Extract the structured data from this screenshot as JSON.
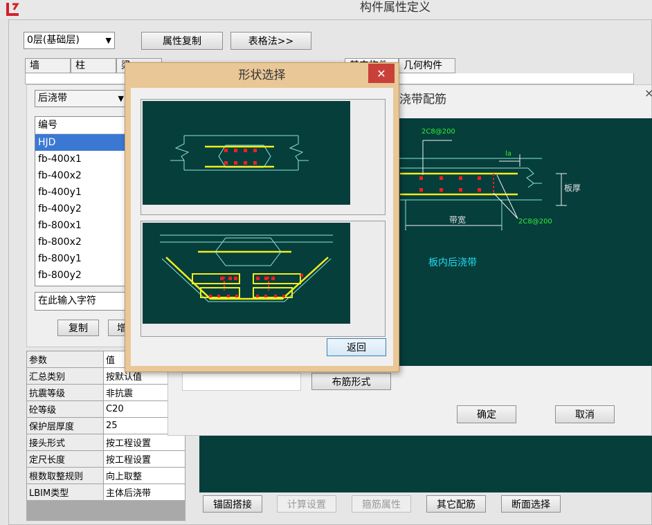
{
  "window": {
    "title": "构件属性定义",
    "logo": "logo-icon"
  },
  "toolbar": {
    "floor_select": "0层(基础层)",
    "copy_props": "属性复制",
    "table_method": "表格法>>"
  },
  "tabs": [
    {
      "label": "墙"
    },
    {
      "label": "柱"
    },
    {
      "label": "梁"
    },
    {
      "label": ""
    },
    {
      "label": ""
    },
    {
      "label": ""
    },
    {
      "label": ""
    },
    {
      "label": "其它构件"
    },
    {
      "label": "几何构件"
    }
  ],
  "component_type": "后浇带",
  "list": {
    "header": "编号",
    "items": [
      "HJD",
      "fb-400x1",
      "fb-400x2",
      "fb-400y1",
      "fb-400y2",
      "fb-800x1",
      "fb-800x2",
      "fb-800y1",
      "fb-800y2"
    ],
    "selected": "HJD",
    "search_placeholder": "在此输入字符",
    "copy_btn": "复制",
    "add_btn": "增"
  },
  "params": {
    "header_key": "参数",
    "header_val": "值",
    "rows": [
      {
        "k": "汇总类别",
        "v": "按默认值"
      },
      {
        "k": "抗震等级",
        "v": "非抗震"
      },
      {
        "k": "砼等级",
        "v": "C20"
      },
      {
        "k": "保护层厚度",
        "v": "25"
      },
      {
        "k": "接头形式",
        "v": "按工程设置"
      },
      {
        "k": "定尺长度",
        "v": "按工程设置"
      },
      {
        "k": "根数取整规则",
        "v": "向上取整"
      },
      {
        "k": "LBIM类型",
        "v": "主体后浇带"
      }
    ]
  },
  "rebar_dialog": {
    "title": "浇带配筋",
    "close": "×",
    "label_top": "2C8@200",
    "label_la": "la",
    "label_thickness": "板厚",
    "label_width": "带宽",
    "label_bottom": "2C8@200",
    "caption": "板内后浇带",
    "layout_btn": "布筋形式",
    "ok": "确定",
    "cancel": "取消"
  },
  "shape_dialog": {
    "title": "形状选择",
    "close": "✕",
    "back": "返回"
  },
  "bottom_buttons": [
    {
      "label": "锚固搭接",
      "enabled": true
    },
    {
      "label": "计算设置",
      "enabled": false
    },
    {
      "label": "箍筋属性",
      "enabled": false
    },
    {
      "label": "其它配筋",
      "enabled": true
    },
    {
      "label": "断面选择",
      "enabled": true
    }
  ],
  "colors": {
    "canvas": "#063e3c",
    "rebar_yellow": "#f2ee1d",
    "rebar_dot": "#ff1d1d",
    "outline": "#8fe6d8",
    "label_green": "#33ee33",
    "caption_cyan": "#22ddee",
    "selection": "#3b78d4",
    "close_red": "#c9403a"
  }
}
